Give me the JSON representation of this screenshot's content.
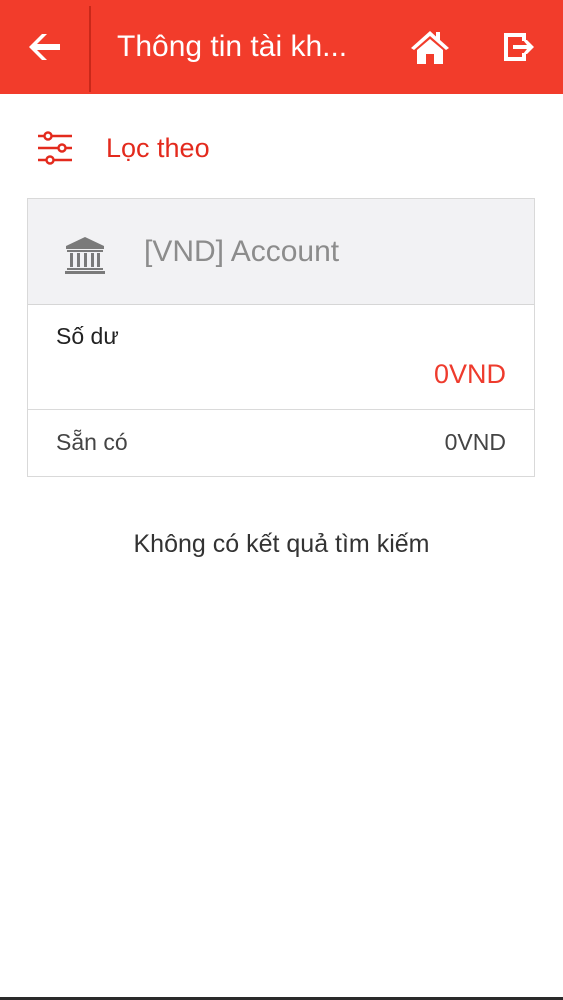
{
  "header": {
    "title": "Thông tin tài kh...",
    "back_icon": "arrow-left-icon",
    "home_icon": "home-icon",
    "logout_icon": "logout-icon",
    "bar_color": "#f23c2b"
  },
  "filter": {
    "label": "Lọc theo",
    "icon": "filter-sliders-icon",
    "color": "#e32a1d"
  },
  "account_card": {
    "icon": "bank-icon",
    "name": "[VND] Account",
    "balance_label": "Số dư",
    "balance_value": "0VND",
    "balance_color": "#ee3b2d",
    "available_label": "Sẵn có",
    "available_value": "0VND"
  },
  "results": {
    "empty_message": "Không có kết quả tìm kiếm"
  }
}
